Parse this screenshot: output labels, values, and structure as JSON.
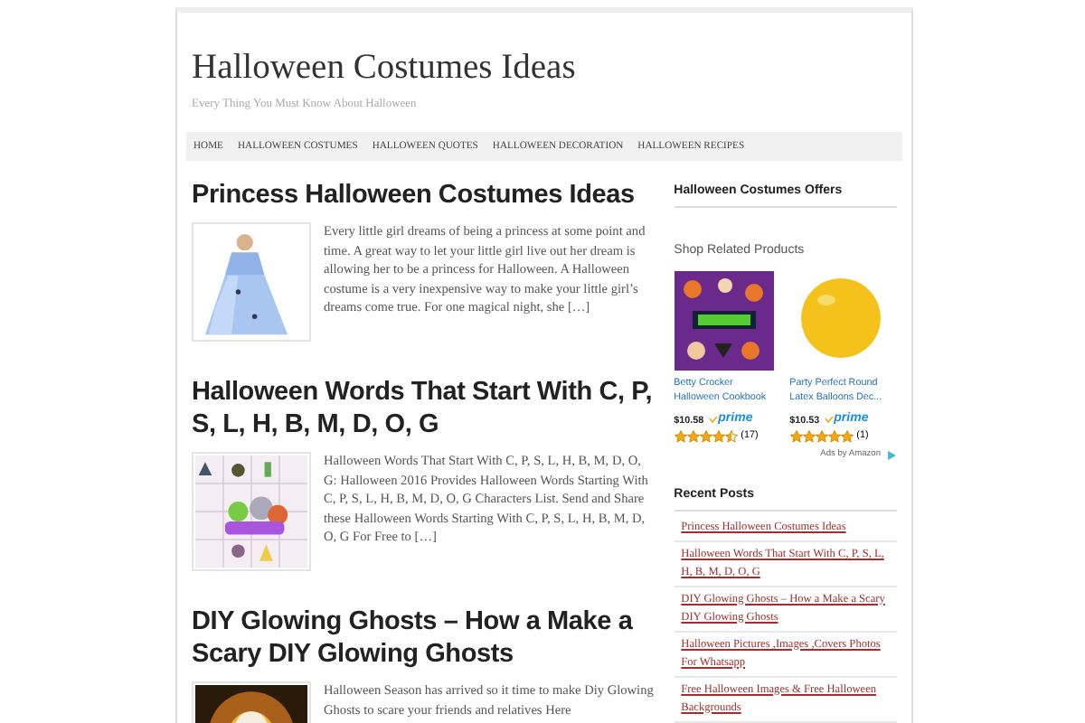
{
  "site": {
    "title": "Halloween Costumes Ideas",
    "tagline": "Every Thing You Must Know About Halloween"
  },
  "nav": [
    {
      "label": "HOME"
    },
    {
      "label": "HALLOWEEN COSTUMES"
    },
    {
      "label": "HALLOWEEN QUOTES"
    },
    {
      "label": "HALLOWEEN DECORATION"
    },
    {
      "label": "HALLOWEEN RECIPES"
    }
  ],
  "posts": [
    {
      "title": "Princess Halloween Costumes Ideas",
      "excerpt": "Every little girl dreams of being a princess at some point and time. A great way to let your little girl live out her dream is allowing her to be a princess for Halloween. A Halloween costume is a very inexpensive way to make your little girl’s dreams come true. For one magical night, she […]"
    },
    {
      "title": "Halloween Words That Start With C, P, S, L, H, B, M, D, O, G",
      "excerpt": "Halloween Words That Start With C, P, S, L, H, B, M, D, O, G: Halloween 2016 Provides Halloween Words Starting With C, P, S, L, H, B, M, D, O, G Characters List. Send and Share these Halloween Words Starting With C, P, S, L, H, B, M, D, O, G For Free to […]"
    },
    {
      "title": "DIY Glowing Ghosts – How a Make a Scary DIY Glowing Ghosts",
      "excerpt": "Halloween Season has arrived so it time to make Diy Glowing Ghosts to scare your friends and relatives Here"
    }
  ],
  "sidebar": {
    "offers_heading": "Halloween Costumes Offers",
    "shop_heading": "Shop Related Products",
    "products": [
      {
        "name": "Betty Crocker Halloween Cookbook",
        "price": "$10.58",
        "prime": "prime",
        "stars": 4.5,
        "count": "(17)"
      },
      {
        "name": "Party Perfect Round Latex Balloons Dec...",
        "price": "$10.53",
        "prime": "prime",
        "stars": 5,
        "count": "(1)"
      }
    ],
    "ads_label": "Ads by Amazon",
    "recent_heading": "Recent Posts",
    "recent": [
      "Princess Halloween Costumes Ideas",
      "Halloween Words That Start With C, P, S, L, H, B, M, D, O, G",
      "DIY Glowing Ghosts – How a Make a Scary DIY Glowing Ghosts",
      "Halloween Pictures ,Images ,Covers Photos For Whatsapp",
      "Free Halloween Images & Free Halloween Backgrounds"
    ]
  }
}
